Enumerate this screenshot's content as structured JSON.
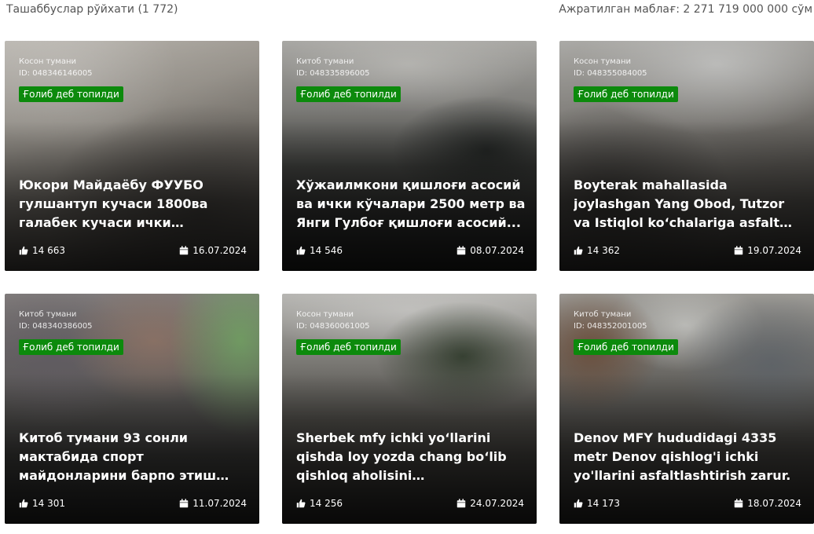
{
  "header": {
    "count_label": "Ташаббуслар рўйхати (1 772)",
    "budget_label": "Ажратилган маблағ: 2 271 719 000 000 сўм"
  },
  "cards": [
    {
      "district": "Косон тумани",
      "id_label": "ID: 048346146005",
      "status": "Ғолиб деб топилди",
      "title": "Юкори Майдаёбу ФУУБО гулшантуп кучаси 1800ва галабек кучаси ички йулларн...",
      "likes": "14 663",
      "date": "16.07.2024"
    },
    {
      "district": "Китоб тумани",
      "id_label": "ID: 048335896005",
      "status": "Ғолиб деб топилди",
      "title": "Хўжаилмкони қишлоғи асосий ва ички кўчалари 2500 метр ва Янги Гулбоғ қишлоғи асосий...",
      "likes": "14 546",
      "date": "08.07.2024"
    },
    {
      "district": "Косон тумани",
      "id_label": "ID: 048355084005",
      "status": "Ғолиб деб топилди",
      "title": "Boyterak mahallasida joylashgan Yang Obod, Tutzor va Istiqlol koʻchalariga asfalt qoplamasi...",
      "likes": "14 362",
      "date": "19.07.2024"
    },
    {
      "district": "Китоб тумани",
      "id_label": "ID: 048340386005",
      "status": "Ғолиб деб топилди",
      "title": "Китоб тумани 93 сонли мактабида спорт майдонларини барпо этиш ва...",
      "likes": "14 301",
      "date": "11.07.2024"
    },
    {
      "district": "Косон тумани",
      "id_label": "ID: 048360061005",
      "status": "Ғолиб деб топилди",
      "title": "Sherbek mfy ichki yoʻllarini qishda loy yozda chang boʻlib qishloq aholisini qiynalayotgani...",
      "likes": "14 256",
      "date": "24.07.2024"
    },
    {
      "district": "Китоб тумани",
      "id_label": "ID: 048352001005",
      "status": "Ғолиб деб топилди",
      "title": "Denov MFY hududidagi 4335 metr Denov qishlog'i ichki yo'llarini asfaltlashtirish zarur.",
      "likes": "14 173",
      "date": "18.07.2024"
    }
  ],
  "colors": {
    "badge_green": "#0c8a0c",
    "overlay_text": "#ffffff",
    "header_text": "#555555"
  },
  "icons": {
    "likes": "thumbs-up-icon",
    "date": "calendar-icon"
  }
}
